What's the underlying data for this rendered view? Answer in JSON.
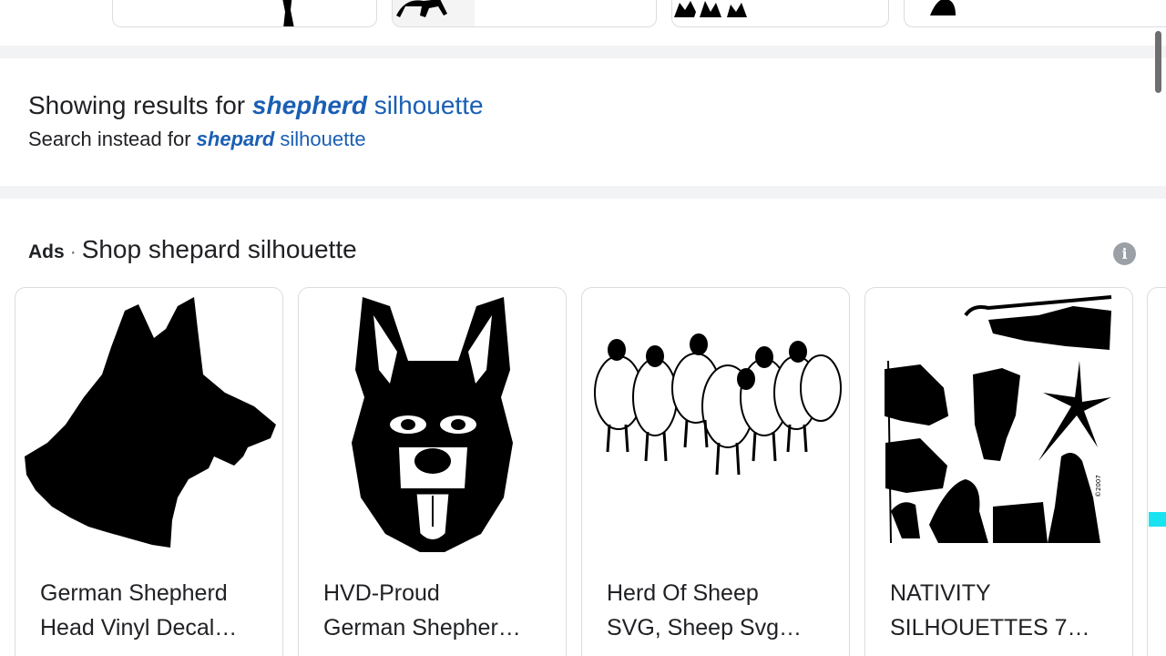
{
  "spelling": {
    "showing_prefix": "Showing results for ",
    "corrected_bold": "shepherd",
    "corrected_rest": " silhouette",
    "instead_prefix": "Search instead for ",
    "original_bold": "shepard",
    "original_rest": " silhouette"
  },
  "ads": {
    "label": "Ads",
    "separator": "·",
    "title": "Shop shepard silhouette",
    "info_icon": "i"
  },
  "products": [
    {
      "line1": "German Shepherd",
      "line2": "Head Vinyl Decal…",
      "image": "german-shepherd-head-silhouette"
    },
    {
      "line1": "HVD-Proud",
      "line2": "German Shepher…",
      "image": "german-shepherd-face-illustration"
    },
    {
      "line1": "Herd Of Sheep",
      "line2": "SVG, Sheep Svg…",
      "image": "sheep-herd-illustration"
    },
    {
      "line1": "NATIVITY",
      "line2": "SILHOUETTES 7…",
      "image": "nativity-silhouettes"
    }
  ],
  "colors": {
    "link": "#1a5fb4",
    "text": "#202124",
    "band": "#f1f3f4",
    "border": "#dadce0"
  }
}
